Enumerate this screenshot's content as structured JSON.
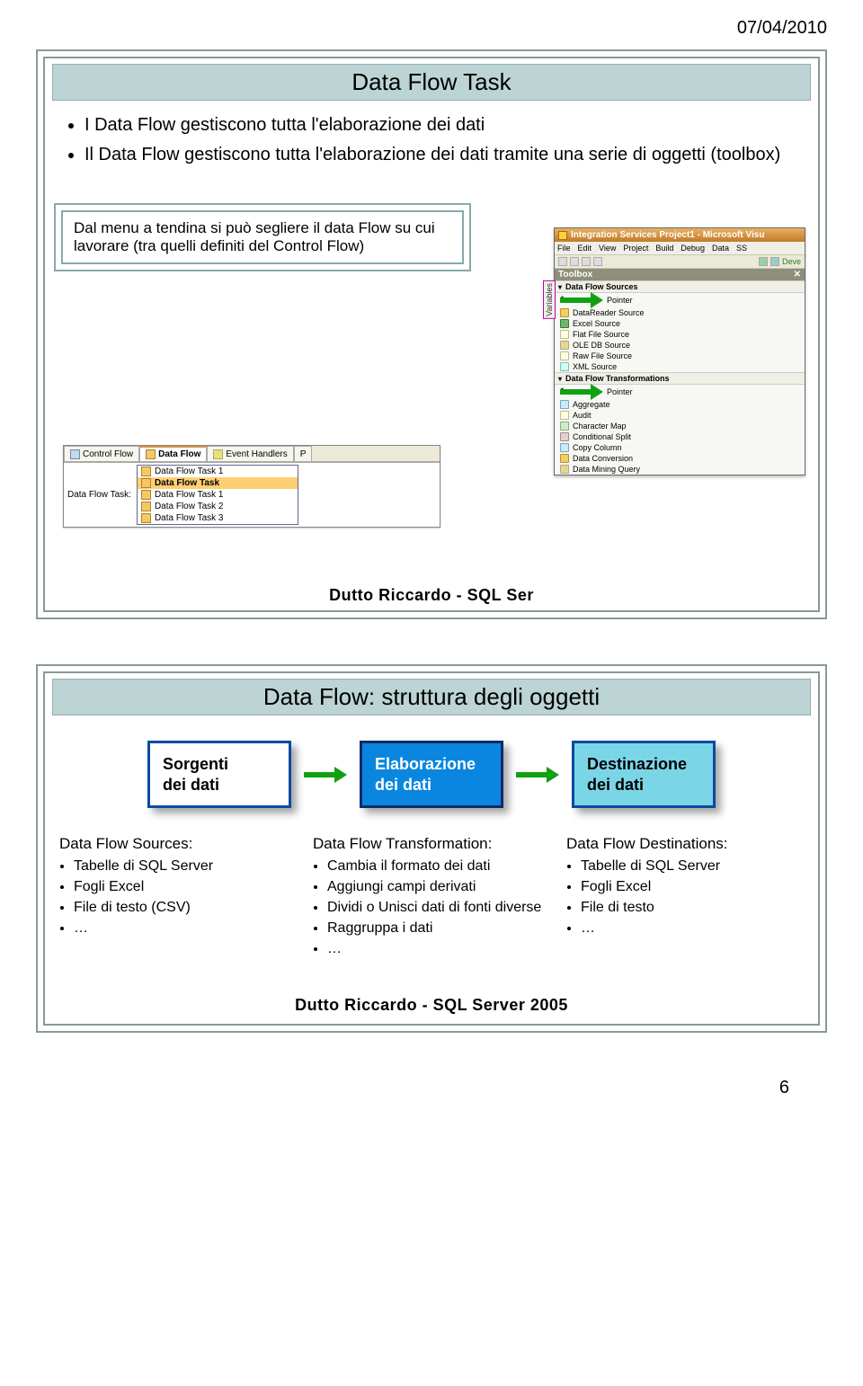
{
  "page_date": "07/04/2010",
  "page_number": "6",
  "footer_text": "Dutto Riccardo   -    SQL Server 2005",
  "footer_text_trunc": "Dutto Riccardo   -    SQL Ser",
  "slide1": {
    "title": "Data Flow Task",
    "bullets": [
      "I Data Flow gestiscono tutta l'elaborazione dei dati",
      "Il Data Flow gestiscono tutta l'elaborazione dei dati tramite una serie di oggetti (toolbox)"
    ],
    "subbox": "Dal menu a tendina si può segliere il data Flow su cui lavorare (tra quelli definiti del Control Flow)",
    "vs": {
      "title_prefix": "Integration Services Project1 - Microsoft Visu",
      "menus": [
        "File",
        "Edit",
        "View",
        "Project",
        "Build",
        "Debug",
        "Data",
        "SS"
      ],
      "toolbar_last": "Deve",
      "toolbox_header": "Toolbox",
      "side_tab": "Variables",
      "section_sources": "Data Flow Sources",
      "items_sources": [
        "Pointer",
        "DataReader Source",
        "Excel Source",
        "Flat File Source",
        "OLE DB Source",
        "Raw File Source",
        "XML Source"
      ],
      "section_transforms": "Data Flow Transformations",
      "items_transforms": [
        "Pointer",
        "Aggregate",
        "Audit",
        "Character Map",
        "Conditional Split",
        "Copy Column",
        "Data Conversion",
        "Data Mining Query"
      ]
    },
    "tabs": {
      "items": [
        "Control Flow",
        "Data Flow",
        "Event Handlers",
        "P"
      ],
      "label": "Data Flow Task:",
      "options": [
        "Data Flow Task 1",
        "Data Flow Task",
        "Data Flow Task 1",
        "Data Flow Task 2",
        "Data Flow Task 3"
      ]
    }
  },
  "slide2": {
    "title": "Data Flow: struttura degli oggetti",
    "box_src_l1": "Sorgenti",
    "box_src_l2": "dei dati",
    "box_mid_l1": "Elaborazione",
    "box_mid_l2": "dei dati",
    "box_dst_l1": "Destinazione",
    "box_dst_l2": "dei dati",
    "col1": {
      "head": "Data Flow Sources:",
      "items": [
        "Tabelle di SQL Server",
        "Fogli Excel",
        "File di testo (CSV)",
        "…"
      ]
    },
    "col2": {
      "head": "Data Flow Transformation:",
      "items": [
        "Cambia il formato dei dati",
        "Aggiungi campi derivati",
        "Dividi o Unisci dati di fonti diverse",
        "Raggruppa i dati",
        "…"
      ]
    },
    "col3": {
      "head": "Data Flow Destinations:",
      "items": [
        "Tabelle di SQL Server",
        "Fogli Excel",
        "File di testo",
        "…"
      ]
    }
  }
}
